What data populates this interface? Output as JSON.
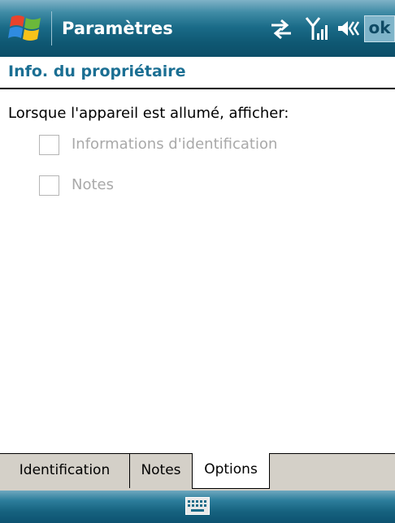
{
  "titlebar": {
    "title": "Paramètres",
    "start_icon": "windows-flag-icon",
    "status_icons": [
      "sync-arrows-icon",
      "signal-strength-icon",
      "speaker-icon"
    ],
    "ok_label": "ok"
  },
  "page": {
    "heading": "Info. du propriétaire",
    "prompt": "Lorsque l'appareil est allumé, afficher:",
    "options": [
      {
        "label": "Informations d'identification",
        "checked": false,
        "enabled": false
      },
      {
        "label": "Notes",
        "checked": false,
        "enabled": false
      }
    ]
  },
  "tabs": [
    {
      "label": "Identification",
      "active": false
    },
    {
      "label": "Notes",
      "active": false
    },
    {
      "label": "Options",
      "active": true
    }
  ],
  "menubar": {
    "center_icon": "keyboard-icon"
  },
  "colors": {
    "heading": "#1b6f93",
    "titlebar": "#1a6b88",
    "disabled_text": "#a9a9a9",
    "tab_background": "#d4d0c8"
  }
}
